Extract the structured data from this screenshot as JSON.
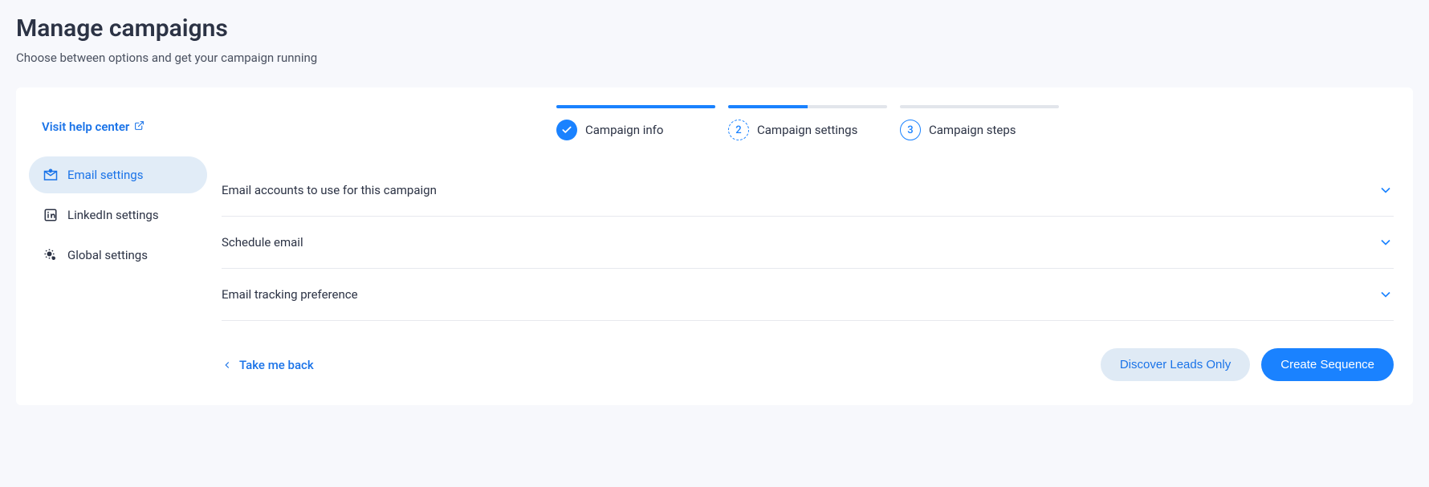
{
  "header": {
    "title": "Manage campaigns",
    "subtitle": "Choose between options and get your campaign running"
  },
  "help_link": {
    "label": "Visit help center"
  },
  "sidebar": {
    "items": [
      {
        "label": "Email settings",
        "active": true
      },
      {
        "label": "LinkedIn settings",
        "active": false
      },
      {
        "label": "Global settings",
        "active": false
      }
    ]
  },
  "stepper": [
    {
      "label": "Campaign info",
      "state": "complete"
    },
    {
      "label": "Campaign settings",
      "number": "2",
      "state": "current"
    },
    {
      "label": "Campaign steps",
      "number": "3",
      "state": "upcoming"
    }
  ],
  "accordion": [
    {
      "title": "Email accounts to use for this campaign"
    },
    {
      "title": "Schedule email"
    },
    {
      "title": "Email tracking preference"
    }
  ],
  "footer": {
    "back_label": "Take me back",
    "secondary_label": "Discover Leads Only",
    "primary_label": "Create Sequence"
  }
}
